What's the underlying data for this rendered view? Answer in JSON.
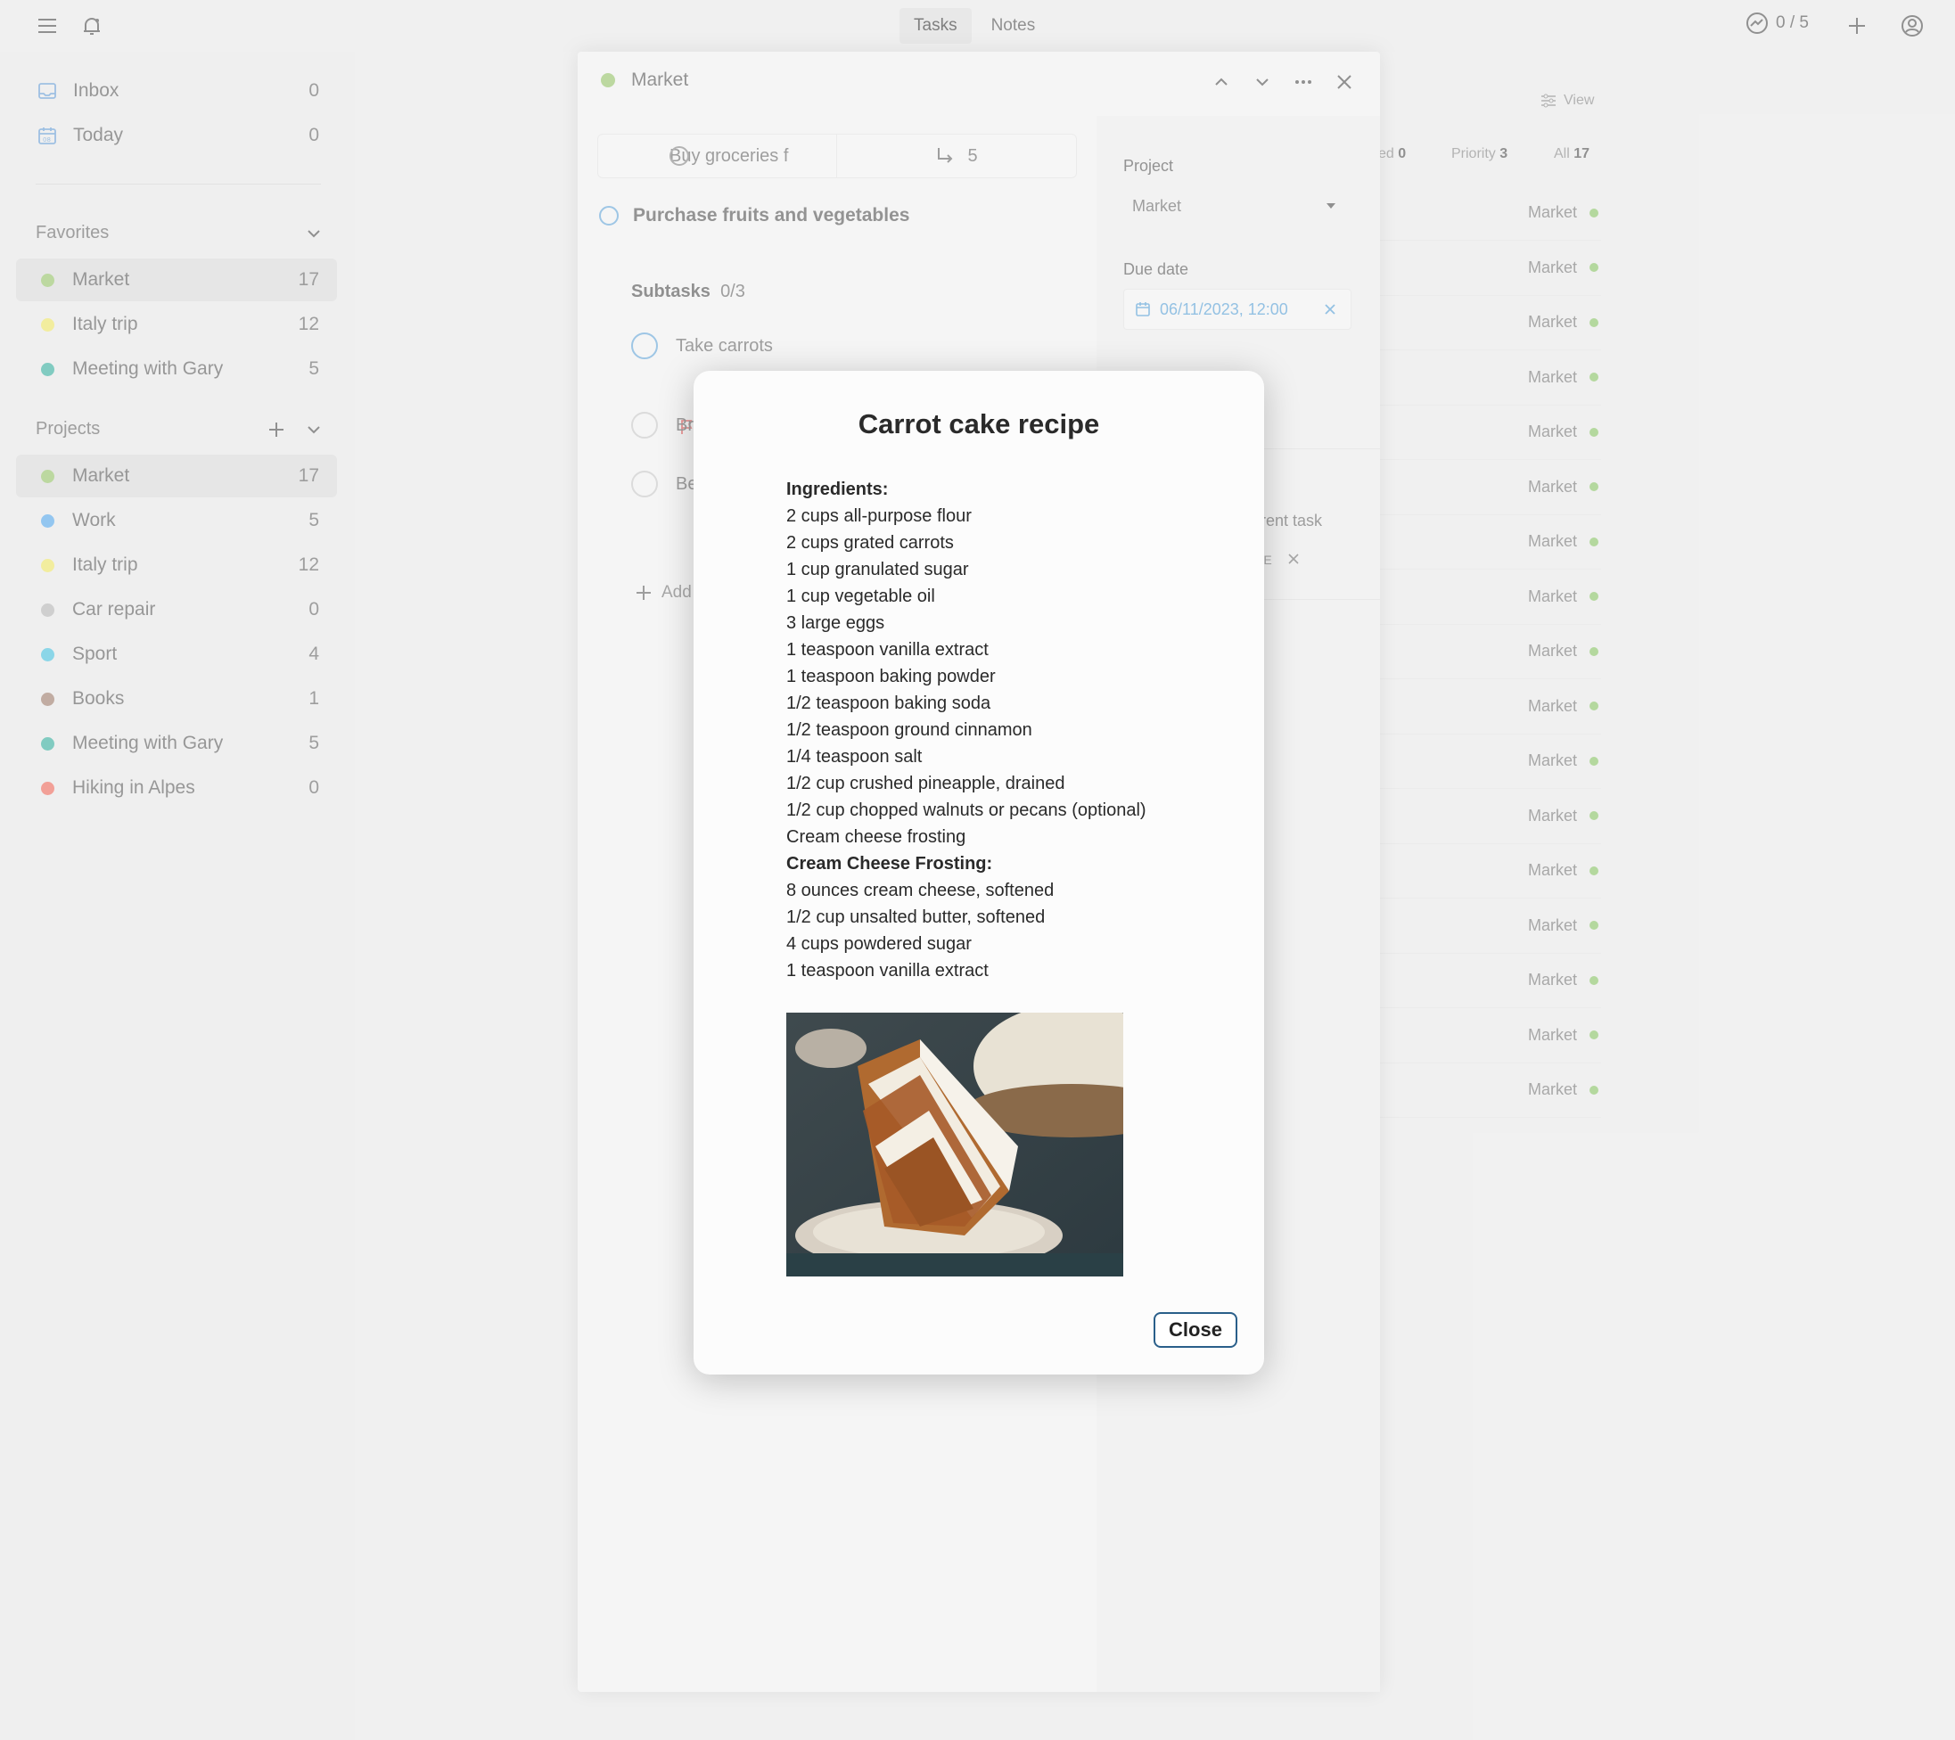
{
  "topbar": {
    "tabs": [
      {
        "label": "Tasks",
        "active": true
      },
      {
        "label": "Notes",
        "active": false
      }
    ],
    "progress": "0 / 5"
  },
  "sidebar": {
    "inbox": {
      "label": "Inbox",
      "count": "0"
    },
    "today": {
      "label": "Today",
      "count": "0"
    },
    "favorites_label": "Favorites",
    "favorites": [
      {
        "label": "Market",
        "count": "17",
        "color": "#98c46e"
      },
      {
        "label": "Italy trip",
        "count": "12",
        "color": "#ece36a"
      },
      {
        "label": "Meeting with Gary",
        "count": "5",
        "color": "#3eb0a0"
      }
    ],
    "projects_label": "Projects",
    "projects": [
      {
        "label": "Market",
        "count": "17",
        "color": "#98c46e"
      },
      {
        "label": "Work",
        "count": "5",
        "color": "#5aa8e8"
      },
      {
        "label": "Italy trip",
        "count": "12",
        "color": "#ece36a"
      },
      {
        "label": "Car repair",
        "count": "0",
        "color": "#b5b5b5"
      },
      {
        "label": "Sport",
        "count": "4",
        "color": "#4ec1dc"
      },
      {
        "label": "Books",
        "count": "1",
        "color": "#a08070"
      },
      {
        "label": "Meeting with Gary",
        "count": "5",
        "color": "#3eb0a0"
      },
      {
        "label": "Hiking in Alpes",
        "count": "0",
        "color": "#ec6e60"
      }
    ]
  },
  "main": {
    "view_label": "View",
    "filters": [
      {
        "label": "ed",
        "count": "0"
      },
      {
        "label": "Priority",
        "count": "3"
      },
      {
        "label": "All",
        "count": "17"
      }
    ],
    "rows": [
      "Market",
      "Market",
      "Market",
      "Market",
      "Market",
      "Market",
      "Market",
      "Market",
      "Market",
      "Market",
      "Market",
      "Market",
      "Market",
      "Market",
      "Market",
      "Market",
      "Market"
    ]
  },
  "panel": {
    "project_title": "Market",
    "parent_task": "Buy groceries f",
    "subtask_link_count": "5",
    "task_title": "Purchase fruits and vegetables",
    "subtasks_label": "Subtasks",
    "subtasks_progress": "0/3",
    "subtasks": [
      "Take carrots",
      "Br",
      "Be"
    ],
    "add_label": "Add",
    "project_label": "Project",
    "project_value": "Market",
    "due_label": "Due date",
    "due_value": "06/11/2023, 12:00",
    "parent_partial": "rent task",
    "tag_partial": "PE"
  },
  "modal": {
    "title": "Carrot cake recipe",
    "ingredients_heading": "Ingredients:",
    "ingredients": [
      "2 cups all-purpose flour",
      "2 cups grated carrots",
      "1 cup granulated sugar",
      "1 cup vegetable oil",
      "3 large eggs",
      "1 teaspoon vanilla extract",
      "1 teaspoon baking powder",
      "1/2 teaspoon baking soda",
      "1/2 teaspoon ground cinnamon",
      "1/4 teaspoon salt",
      "1/2 cup crushed pineapple, drained",
      "1/2 cup chopped walnuts or pecans (optional)",
      "Cream cheese frosting"
    ],
    "frosting_heading": "Cream Cheese Frosting:",
    "frosting": [
      "8 ounces cream cheese, softened",
      "1/2 cup unsalted butter, softened",
      "4 cups powdered sugar",
      "1 teaspoon vanilla extract"
    ],
    "close_label": "Close"
  }
}
